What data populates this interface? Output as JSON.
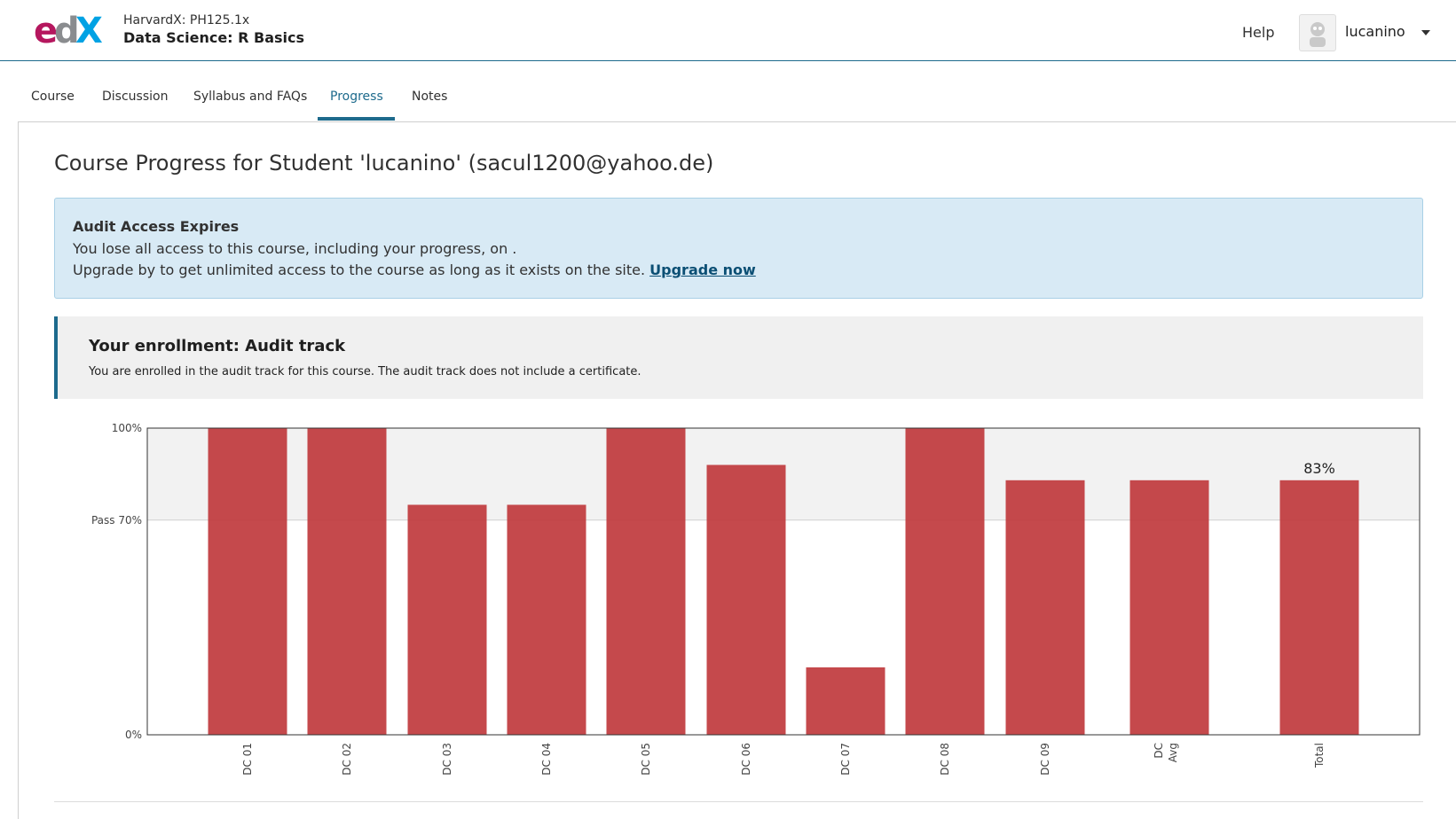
{
  "header": {
    "course_org": "HarvardX: PH125.1x",
    "course_name": "Data Science: R Basics",
    "help_label": "Help",
    "username": "lucanino"
  },
  "tabs": [
    {
      "label": "Course",
      "active": false
    },
    {
      "label": "Discussion",
      "active": false
    },
    {
      "label": "Syllabus and FAQs",
      "active": false
    },
    {
      "label": "Progress",
      "active": true
    },
    {
      "label": "Notes",
      "active": false
    }
  ],
  "page": {
    "title": "Course Progress for Student 'lucanino' (sacul1200@yahoo.de)"
  },
  "audit": {
    "title": "Audit Access Expires",
    "line1": "You lose all access to this course, including your progress, on .",
    "line2": "Upgrade by to get unlimited access to the course as long as it exists on the site.",
    "upgrade_link": "Upgrade now"
  },
  "enrollment": {
    "title": "Your enrollment: Audit track",
    "text": "You are enrolled in the audit track for this course. The audit track does not include a certificate."
  },
  "colors": {
    "bar": "#c0393d",
    "accent": "#1d6a8c",
    "pass_band": "#f2f2f2"
  },
  "chart_data": {
    "type": "bar",
    "categories": [
      "DC 01",
      "DC 02",
      "DC 03",
      "DC 04",
      "DC 05",
      "DC 06",
      "DC 07",
      "DC 08",
      "DC 09",
      "DC Avg",
      "Total"
    ],
    "values": [
      100,
      100,
      75,
      75,
      100,
      88,
      22,
      100,
      83,
      83,
      83
    ],
    "ylim": [
      0,
      100
    ],
    "y_ticks": [
      "0%",
      "Pass 70%",
      "100%"
    ],
    "pass_threshold": 70,
    "data_labels": {
      "Total": "83%"
    }
  }
}
